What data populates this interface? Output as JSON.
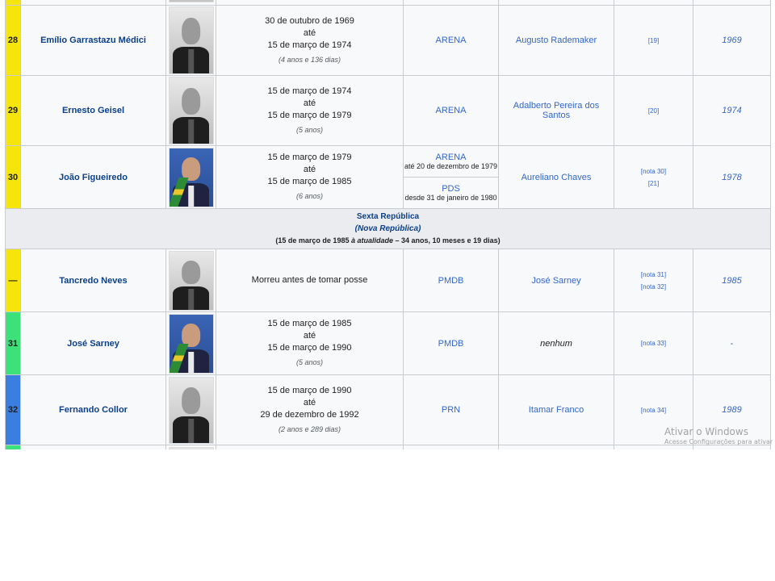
{
  "rows_top": [
    {
      "number": "28",
      "color": "#f6e50b",
      "name": "Emílio Garrastazu Médici",
      "photo": "bw",
      "term_start": "30 de outubro de 1969",
      "term_sep": "até",
      "term_end": "15 de março de 1974",
      "duration": "(4 anos e 136 dias)",
      "party": "ARENA",
      "vice": "Augusto Rademaker",
      "refs": [
        "[19]"
      ],
      "election": "1969"
    },
    {
      "number": "29",
      "color": "#f6e50b",
      "name": "Ernesto Geisel",
      "photo": "bw",
      "term_start": "15 de março de 1974",
      "term_sep": "até",
      "term_end": "15 de março de 1979",
      "duration": "(5 anos)",
      "party": "ARENA",
      "vice": "Adalberto Pereira dos Santos",
      "refs": [
        "[20]"
      ],
      "election": "1974"
    }
  ],
  "row_figueiredo": {
    "number": "30",
    "color": "#f6e50b",
    "name": "João Figueiredo",
    "photo": "col",
    "term_start": "15 de março de 1979",
    "term_sep": "até",
    "term_end": "15 de março de 1985",
    "duration": "(6 anos)",
    "party1": "ARENA",
    "party1_sub": "até 20 de dezembro de 1979",
    "party2": "PDS",
    "party2_sub": "desde 31 de janeiro de 1980",
    "vice": "Aureliano Chaves",
    "refs": [
      "[nota 30]",
      "[21]"
    ],
    "election": "1978"
  },
  "republic": {
    "title": "Sexta República",
    "subtitle": "(Nova República)",
    "period_start": "(15 de março de 1985 ",
    "period_italic": "à atualidade",
    "period_end": " – 34 anos, 10 meses e 19 dias)"
  },
  "rows_bottom": [
    {
      "number": "—",
      "color": "#f6e50b",
      "name": "Tancredo Neves",
      "photo": "bw",
      "note": "Morreu antes de tomar posse",
      "party": "PMDB",
      "vice": "José Sarney",
      "refs": [
        "[nota 31]",
        "[nota 32]"
      ],
      "election": "1985"
    },
    {
      "number": "31",
      "color": "#3ee07a",
      "name": "José Sarney",
      "photo": "col",
      "term_start": "15 de março de 1985",
      "term_sep": "até",
      "term_end": "15 de março de 1990",
      "duration": "(5 anos)",
      "party": "PMDB",
      "vice": "nenhum",
      "refs": [
        "[nota 33]"
      ],
      "election": "-"
    },
    {
      "number": "32",
      "color": "#3a7fe0",
      "name": "Fernando Collor",
      "photo": "bw",
      "term_start": "15 de março de 1990",
      "term_sep": "até",
      "term_end": "29 de dezembro de 1992",
      "duration": "(2 anos e 289 dias)",
      "party": "PRN",
      "vice": "Itamar Franco",
      "refs": [
        "[nota 34]"
      ],
      "election": "1989"
    }
  ],
  "next_row_color": "#3ee07a",
  "watermark": {
    "line1": "Ativar o Windows",
    "line2": "Acesse Configurações para ativar"
  }
}
